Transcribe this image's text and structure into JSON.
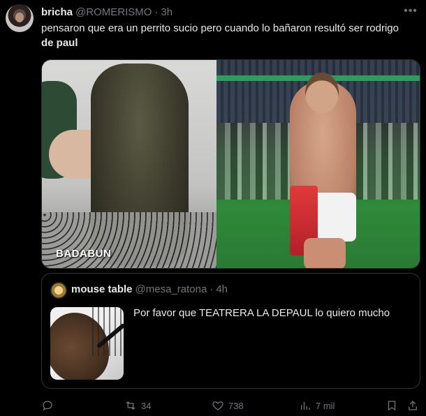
{
  "tweet": {
    "author_name": "bricha",
    "author_handle": "@ROMERISMO",
    "separator": "·",
    "time": "3h",
    "text_main": "pensaron que era un perrito sucio pero cuando lo bañaron resultó ser rodrigo ",
    "text_bold": "de paul",
    "more_icon": "more-dots-icon"
  },
  "media": {
    "left_watermark": "BADABUN"
  },
  "quote": {
    "author_name": "mouse table",
    "author_handle": "@mesa_ratona",
    "separator": "·",
    "time": "4h",
    "text": "Por favor que TEATRERA LA DEPAUL lo quiero mucho"
  },
  "actions": {
    "reply_count": "",
    "retweet_count": "34",
    "like_count": "738",
    "views_count": "7 mil"
  }
}
